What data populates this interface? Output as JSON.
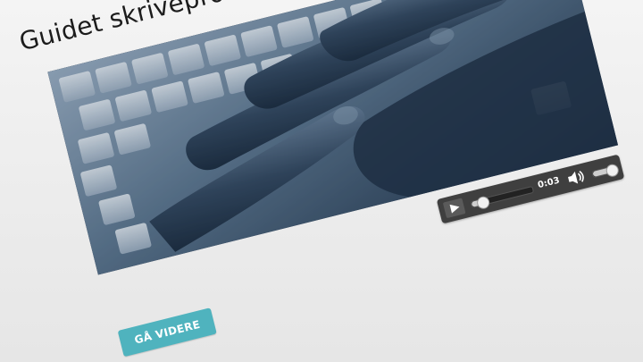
{
  "page": {
    "title": "Guidet skriveproces"
  },
  "video": {
    "image_subject": "hands typing on keyboard",
    "tint_color": "#2f4660"
  },
  "player": {
    "current_time": "0:03",
    "progress_fraction": 0.17,
    "volume_fraction": 0.8,
    "play_icon": "play-icon",
    "volume_icon": "speaker-icon"
  },
  "actions": {
    "next_label": "GÅ VIDERE",
    "accent_color": "#4fb3be"
  }
}
